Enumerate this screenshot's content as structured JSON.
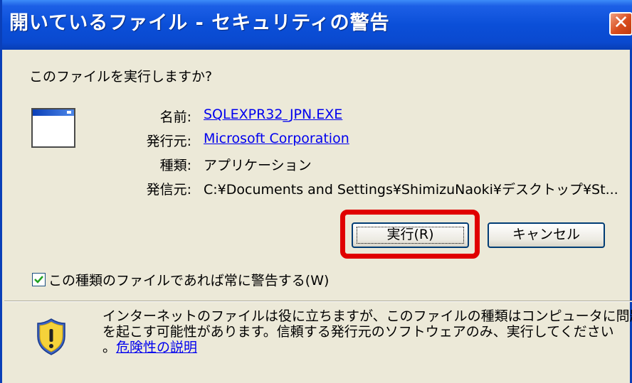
{
  "window": {
    "title": "開いているファイル - セキュリティの警告",
    "close_label": "✕"
  },
  "prompt": {
    "question": "このファイルを実行しますか?"
  },
  "icons": {
    "app": "application-window-icon",
    "warning": "security-shield-warning-icon"
  },
  "fields": {
    "name_label": "名前:",
    "name_value": "SQLEXPR32_JPN.EXE",
    "publisher_label": "発行元:",
    "publisher_value": "Microsoft Corporation",
    "type_label": "種類:",
    "type_value": "アプリケーション",
    "source_label": "発信元:",
    "source_value": "C:¥Documents and Settings¥ShimizuNaoki¥デスクトップ¥St..."
  },
  "buttons": {
    "run": "実行(R)",
    "cancel": "キャンセル"
  },
  "checkbox": {
    "checked": true,
    "label": "この種類のファイルであれば常に警告する(W)"
  },
  "warning": {
    "line1": "インターネットのファイルは役に立ちますが、このファイルの種類はコンピュータに問題",
    "line2": "を起こす可能性があります。信頼する発行元のソフトウェアのみ、実行してください",
    "line3_prefix": "。",
    "risk_link": "危険性の説明"
  },
  "colors": {
    "titlebar": "#0a49cf",
    "dialog_bg": "#ece9d8",
    "link": "#0000ee",
    "highlight": "#e00000"
  }
}
